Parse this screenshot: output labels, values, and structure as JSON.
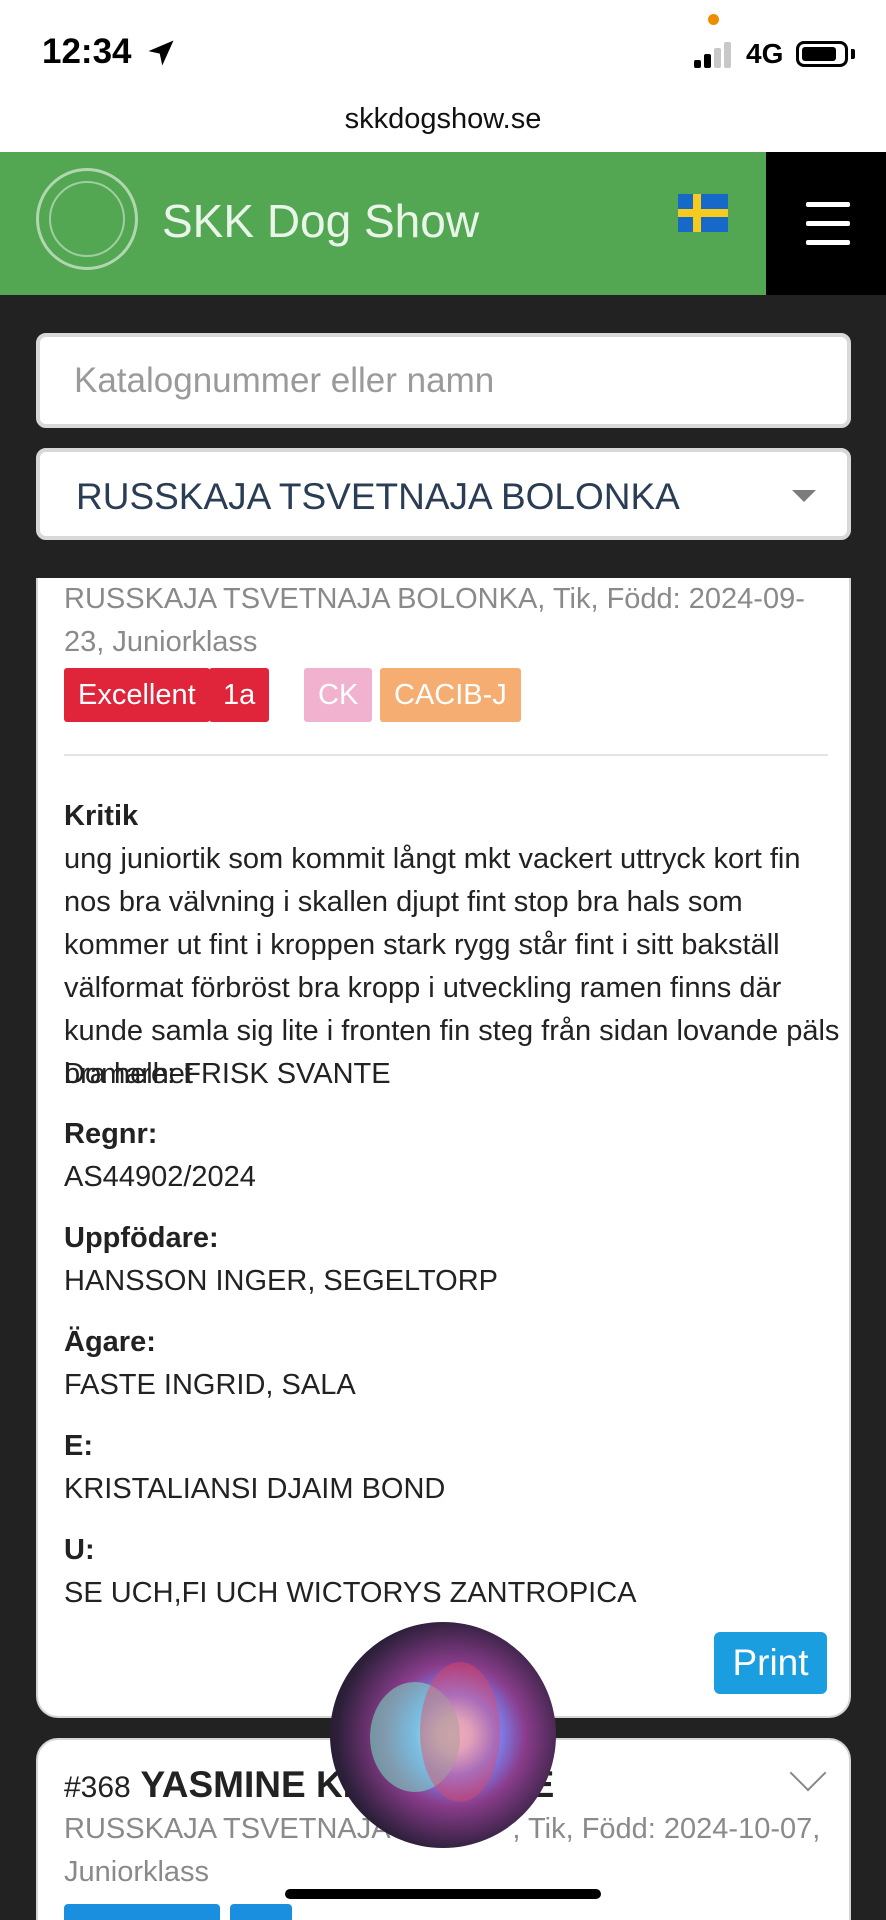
{
  "status_bar": {
    "time": "12:34",
    "network": "4G"
  },
  "browser": {
    "url": "skkdogshow.se"
  },
  "header": {
    "brand": "SKK Dog Show"
  },
  "search": {
    "placeholder": "Katalognummer eller namn"
  },
  "breed_select": {
    "selected": "RUSSKAJA TSVETNAJA BOLONKA"
  },
  "result": {
    "subtitle": "RUSSKAJA TSVETNAJA BOLONKA, Tik, Född: 2024-09-23, Juniorklass",
    "badges": [
      "Excellent",
      "1a",
      "CK",
      "CACIB-J"
    ],
    "critique_label": "Kritik",
    "critique_text": "ung juniortik som kommit långt mkt vackert uttryck kort fin nos bra välvning i skallen djupt fint stop bra hals som kommer ut fint i kroppen stark rygg står fint i sitt bakställ välformat förbröst bra kropp i utveckling ramen finns där kunde samla sig lite i fronten fin steg från sidan lovande päls bra helhet",
    "judge_text": "Domare: FRISK SVANTE",
    "regnr_label": "Regnr:",
    "regnr_value": "AS44902/2024",
    "breeder_label": "Uppfödare:",
    "breeder_value": "HANSSON INGER, SEGELTORP",
    "owner_label": "Ägare:",
    "owner_value": "FASTE INGRID, SALA",
    "sire_label": "E:",
    "sire_value": "KRISTALIANSI DJAIM BOND",
    "dam_label": "U:",
    "dam_value": "SE UCH,FI UCH WICTORYS ZANTROPICA",
    "print_label": "Print"
  },
  "next_result": {
    "number": "#368",
    "name_visible": "YASMINE KIN",
    "name_tail_visible": "E",
    "subtitle_start": "RUSSKAJA TSVETNAJA B",
    "subtitle_end": ", Tik, Född: 2024-10-07,",
    "subtitle_line2": "Juniorklass"
  },
  "colors": {
    "header_green": "#53a753",
    "badge_red": "#e0253a",
    "badge_pink": "#f1b2cf",
    "badge_orange": "#f5ad72",
    "print_blue": "#1a9ee0"
  }
}
